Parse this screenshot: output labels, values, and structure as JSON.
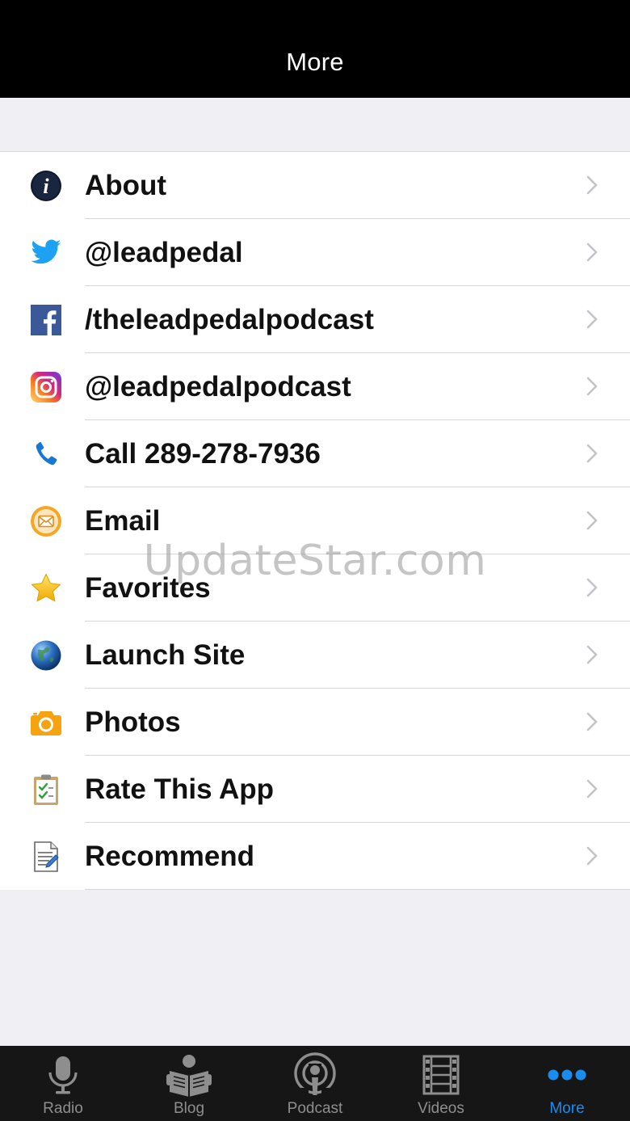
{
  "header": {
    "title": "More"
  },
  "menu": [
    {
      "label": "About",
      "icon": "info-icon"
    },
    {
      "label": "@leadpedal",
      "icon": "twitter-icon"
    },
    {
      "label": "/theleadpedalpodcast",
      "icon": "facebook-icon"
    },
    {
      "label": "@leadpedalpodcast",
      "icon": "instagram-icon"
    },
    {
      "label": "Call 289-278-7936",
      "icon": "phone-icon"
    },
    {
      "label": "Email",
      "icon": "email-icon"
    },
    {
      "label": "Favorites",
      "icon": "star-icon"
    },
    {
      "label": "Launch Site",
      "icon": "globe-icon"
    },
    {
      "label": "Photos",
      "icon": "camera-icon"
    },
    {
      "label": "Rate This App",
      "icon": "clipboard-icon"
    },
    {
      "label": "Recommend",
      "icon": "document-edit-icon"
    }
  ],
  "watermark": "UpdateStar.com",
  "tabs": [
    {
      "label": "Radio",
      "icon": "microphone-icon",
      "active": false
    },
    {
      "label": "Blog",
      "icon": "reader-icon",
      "active": false
    },
    {
      "label": "Podcast",
      "icon": "podcast-icon",
      "active": false
    },
    {
      "label": "Videos",
      "icon": "film-icon",
      "active": false
    },
    {
      "label": "More",
      "icon": "more-dots-icon",
      "active": true
    }
  ],
  "colors": {
    "active_tab": "#1a8cf0",
    "inactive_tab": "#8e8e8e",
    "twitter": "#1da1f2",
    "facebook": "#3b5998",
    "phone": "#1478d4",
    "email": "#f5a623"
  }
}
